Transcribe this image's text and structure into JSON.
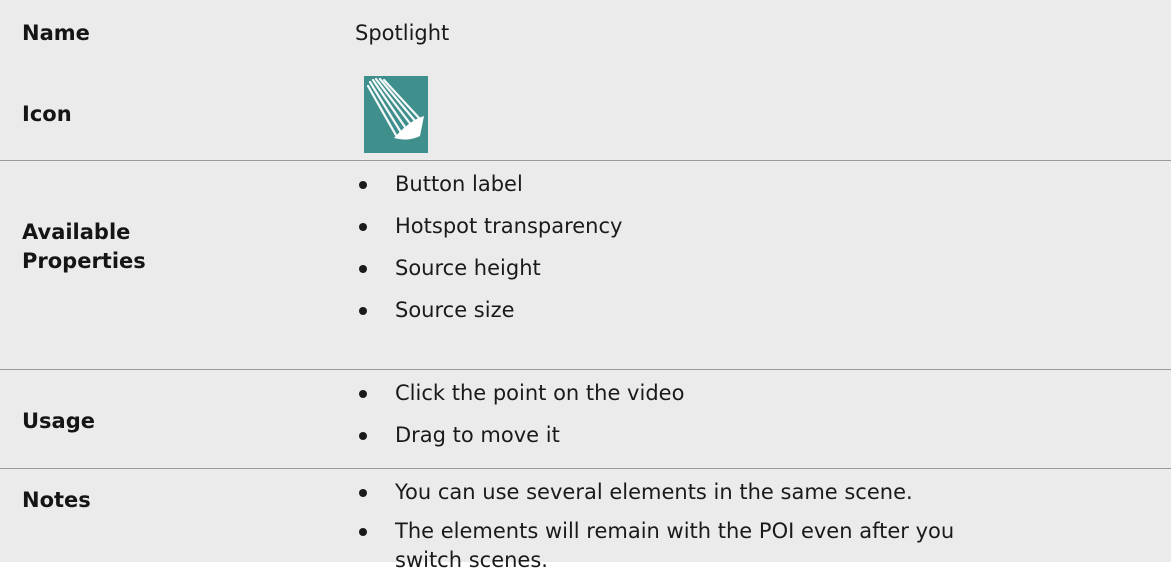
{
  "rows": {
    "name": {
      "label": "Name",
      "value": "Spotlight"
    },
    "icon": {
      "label": "Icon",
      "icon_name": "spotlight-icon",
      "icon_color": "#3f8f8d"
    },
    "properties": {
      "label": "Available Properties",
      "items": [
        "Button label",
        "Hotspot transparency",
        "Source height",
        "Source size"
      ]
    },
    "usage": {
      "label": "Usage",
      "items": [
        "Click the point on the video",
        "Drag to move it"
      ]
    },
    "notes": {
      "label": "Notes",
      "items": [
        "You can use several elements in the same scene.",
        "The elements will remain with the POI even after you switch scenes."
      ]
    }
  },
  "colors": {
    "row_background": "#ebebeb",
    "divider": "#9a9a9a",
    "icon_background": "#3f8f8d"
  }
}
